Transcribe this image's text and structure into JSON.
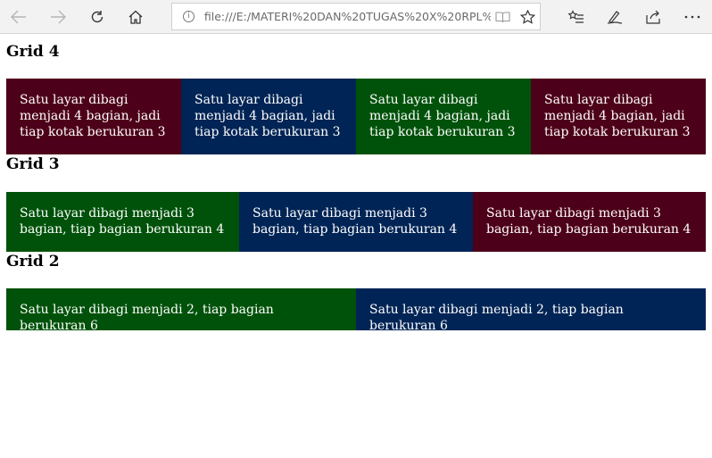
{
  "browser": {
    "url": "file:///E:/MATERI%20DAN%20TUGAS%20X%20RPL%2",
    "icons": [
      "back-icon",
      "forward-icon",
      "refresh-icon",
      "home-icon",
      "info-icon",
      "reading-view-icon",
      "favorite-star-icon",
      "favorites-list-icon",
      "pen-icon",
      "share-icon",
      "more-icon"
    ]
  },
  "page": {
    "sections": [
      {
        "heading": "Grid 4",
        "boxes": [
          "Satu layar dibagi menjadi 4 bagian, jadi tiap kotak berukuran 3",
          "Satu layar dibagi menjadi 4 bagian, jadi tiap kotak berukuran 3",
          "Satu layar dibagi menjadi 4 bagian, jadi tiap kotak berukuran 3",
          "Satu layar dibagi menjadi 4 bagian, jadi tiap kotak berukuran 3"
        ]
      },
      {
        "heading": "Grid 3",
        "boxes": [
          "Satu layar dibagi menjadi 3 bagian, tiap bagian berukuran 4",
          "Satu layar dibagi menjadi 3 bagian, tiap bagian berukuran 4",
          "Satu layar dibagi menjadi 3 bagian, tiap bagian berukuran 4"
        ]
      },
      {
        "heading": "Grid 2",
        "boxes": [
          "Satu layar dibagi menjadi 2, tiap bagian berukuran 6",
          "Satu layar dibagi menjadi 2, tiap bagian berukuran 6"
        ]
      }
    ]
  },
  "colors": {
    "maroon": "#4d0019",
    "navy": "#002455",
    "green": "#00520a"
  }
}
